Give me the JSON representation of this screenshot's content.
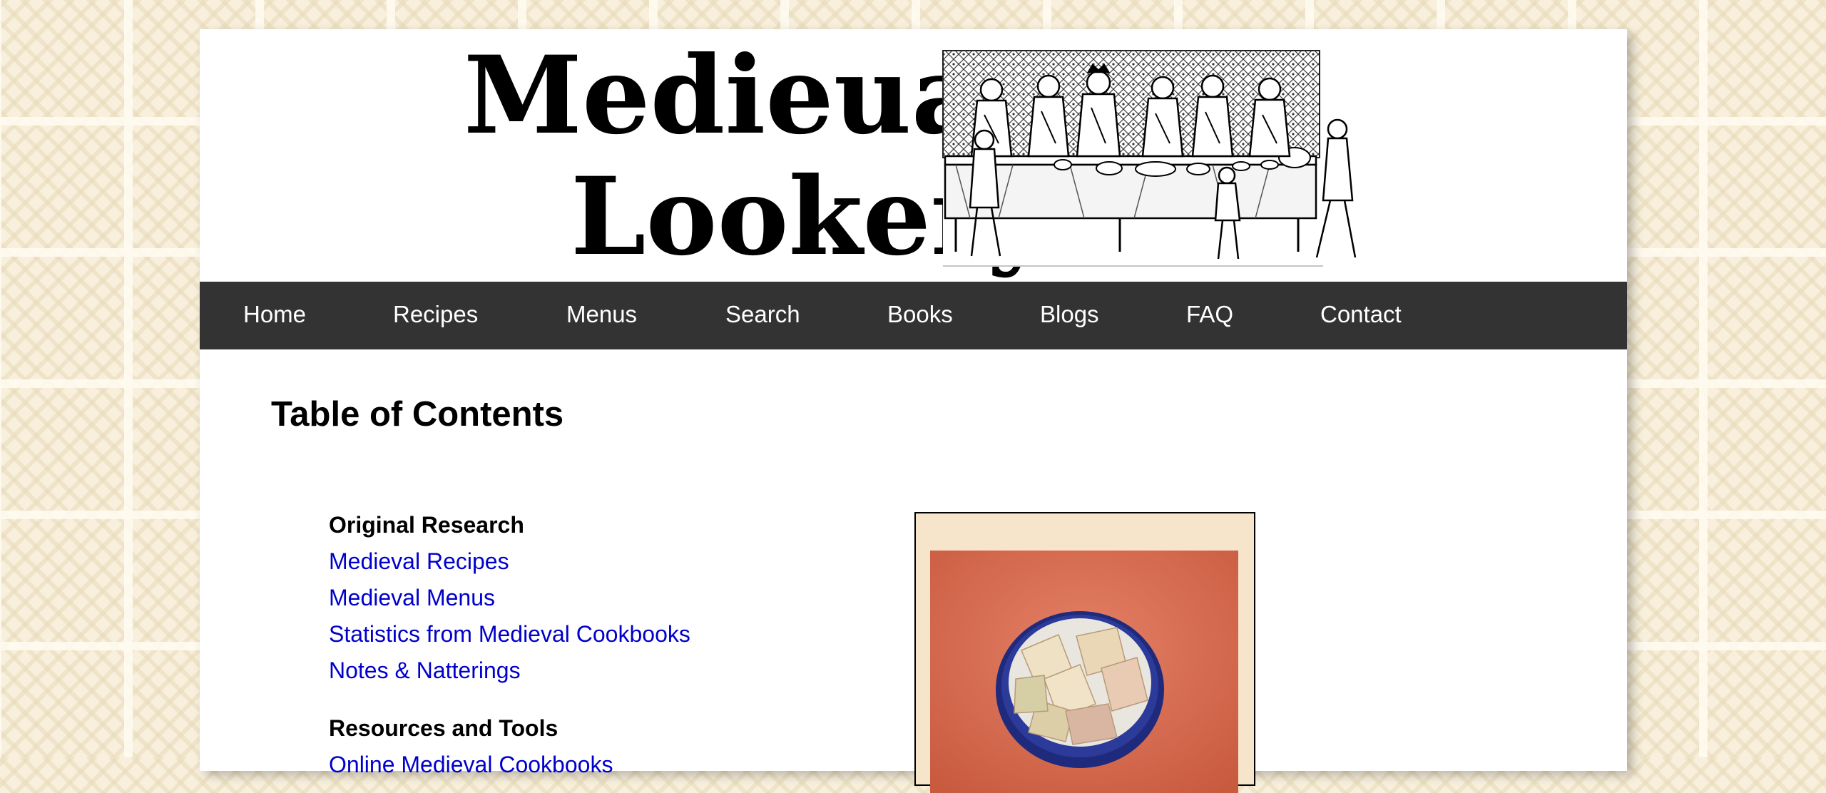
{
  "header": {
    "logo_text": "Medieual Lookery",
    "logo_line1": "Medieual",
    "logo_line2": "Lookery"
  },
  "nav": {
    "items": [
      {
        "label": "Home"
      },
      {
        "label": "Recipes"
      },
      {
        "label": "Menus"
      },
      {
        "label": "Search"
      },
      {
        "label": "Books"
      },
      {
        "label": "Blogs"
      },
      {
        "label": "FAQ"
      },
      {
        "label": "Contact"
      }
    ]
  },
  "main": {
    "title": "Table of Contents",
    "sections": [
      {
        "heading": "Original Research",
        "links": [
          "Medieval Recipes",
          "Medieval Menus",
          "Statistics from Medieval Cookbooks",
          "Notes & Natterings"
        ]
      },
      {
        "heading": "Resources and Tools",
        "links": [
          "Online Medieval Cookbooks"
        ]
      }
    ]
  },
  "colors": {
    "nav_bg": "#333333",
    "link": "#0000cc",
    "photo_frame_bg": "#f6e4cb",
    "photo_table": "#d8704f",
    "bowl": "#1f2a7c"
  }
}
